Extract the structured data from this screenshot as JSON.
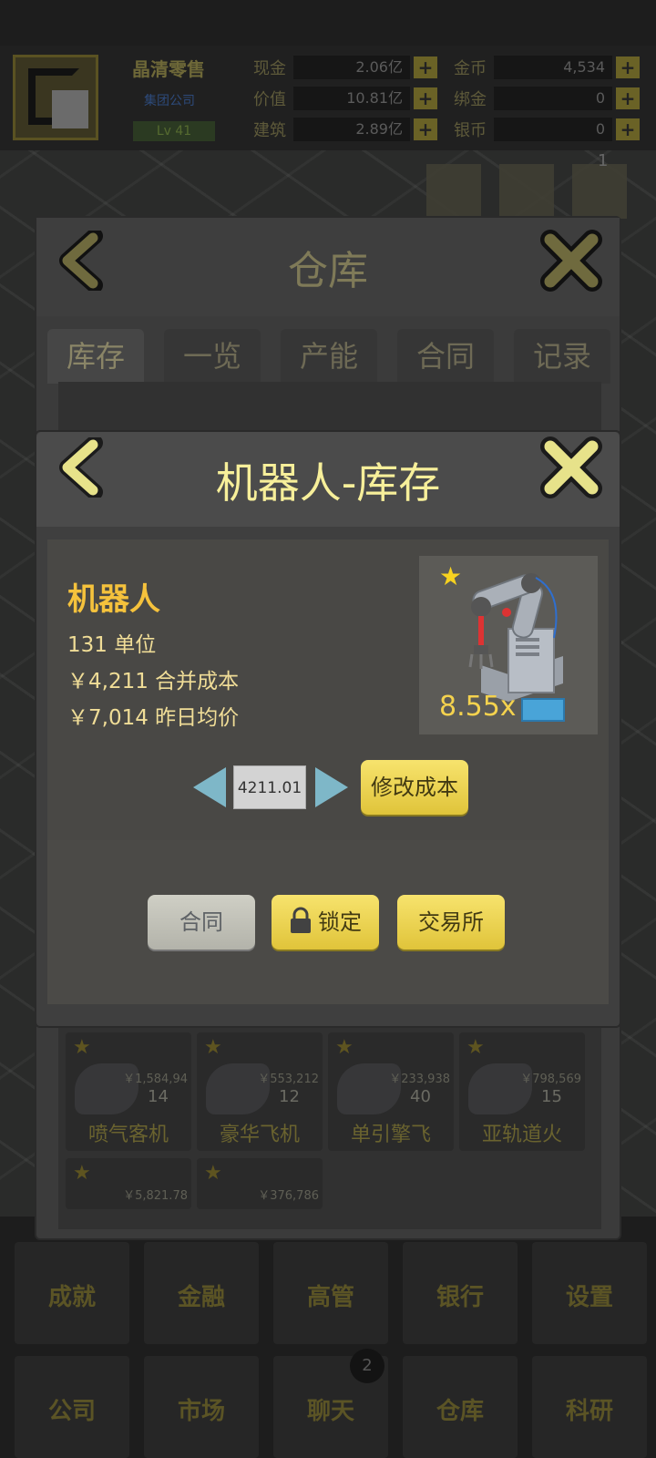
{
  "top": {
    "company_name": "晶清零售",
    "company_type": "集团公司",
    "level": "Lv 41",
    "resources_left": [
      {
        "label": "现金",
        "value": "2.06亿"
      },
      {
        "label": "价值",
        "value": "10.81亿"
      },
      {
        "label": "建筑",
        "value": "2.89亿"
      }
    ],
    "resources_right": [
      {
        "label": "金币",
        "value": "4,534"
      },
      {
        "label": "绑金",
        "value": "0"
      },
      {
        "label": "银币",
        "value": "0"
      }
    ],
    "plus": "+",
    "notification_badge": "1"
  },
  "warehouse": {
    "title": "仓库",
    "tabs": [
      {
        "label": "库存",
        "active": true
      },
      {
        "label": "一览"
      },
      {
        "label": "产能"
      },
      {
        "label": "合同"
      },
      {
        "label": "记录"
      }
    ],
    "items": [
      {
        "name": "喷气客机",
        "price": "￥1,584,94",
        "qty": "14"
      },
      {
        "name": "豪华飞机",
        "price": "￥553,212",
        "qty": "12"
      },
      {
        "name": "单引擎飞",
        "price": "￥233,938",
        "qty": "40"
      },
      {
        "name": "亚轨道火",
        "price": "￥798,569",
        "qty": "15"
      },
      {
        "name": "",
        "price": "￥5,821.78",
        "qty": ""
      },
      {
        "name": "",
        "price": "￥376,786",
        "qty": ""
      }
    ],
    "star": "★"
  },
  "modal": {
    "title": "机器人-库存",
    "item_name": "机器人",
    "units": "131 单位",
    "merged_cost": "￥4,211 合并成本",
    "avg_price": "￥7,014 昨日均价",
    "multiplier": "8.55x",
    "star": "★",
    "cost_value": "4211.01",
    "modify_cost_button": "修改成本",
    "contract_button": "合同",
    "lock_button": "锁定",
    "exchange_button": "交易所"
  },
  "bottom_nav": {
    "row1": [
      "成就",
      "金融",
      "高管",
      "银行",
      "设置"
    ],
    "row2": [
      "公司",
      "市场",
      "聊天",
      "仓库",
      "科研"
    ],
    "chat_badge": "2"
  },
  "colors": {
    "modal_title": "#f7ef9a",
    "item_name": "#f5c23c",
    "info_text": "#f0dd97",
    "button_yellow": "#f0d24e",
    "button_gray": "#c2c2b8",
    "arrow": "#7eb7c8"
  },
  "icons": [
    "back-chevron-icon",
    "close-x-icon",
    "star-icon",
    "robot-arm-icon",
    "container-icon",
    "lock-icon",
    "arrow-left-icon",
    "arrow-right-icon"
  ]
}
